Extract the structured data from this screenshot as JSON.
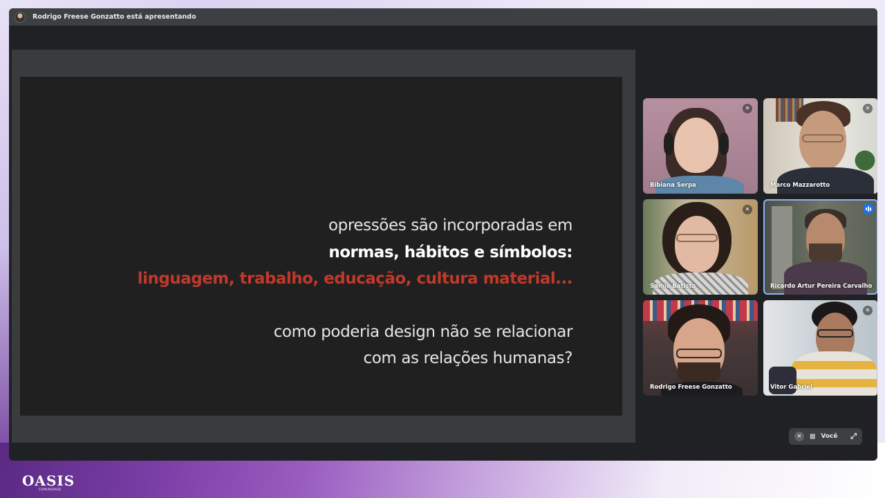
{
  "presenter_banner": "Rodrigo Freese Gonzatto está apresentando",
  "slide": {
    "line1": "opressões são incorporadas em",
    "line2": "normas, hábitos e símbolos:",
    "line3": "linguagem, trabalho, educação, cultura material...",
    "line4": "como poderia design não se relacionar",
    "line5": "com as relações humanas?"
  },
  "participants": [
    {
      "name": "Bibiana Serpa",
      "muted": true
    },
    {
      "name": "Marco Mazzarotto",
      "muted": true
    },
    {
      "name": "Samia Batista",
      "muted": true
    },
    {
      "name": "Ricardo Artur Pereira Carvalho",
      "speaking": true
    },
    {
      "name": "Rodrigo Freese Gonzatto",
      "muted": false
    },
    {
      "name": "Vitor Gabriel",
      "muted": true
    }
  ],
  "self_view": {
    "label": "Você"
  },
  "brand": {
    "logo": "OASIS",
    "tagline": "COMUNIDADE"
  },
  "colors": {
    "accent_red": "#c0392b",
    "speaking_blue": "#1a73e8",
    "window_bg": "#202124"
  }
}
